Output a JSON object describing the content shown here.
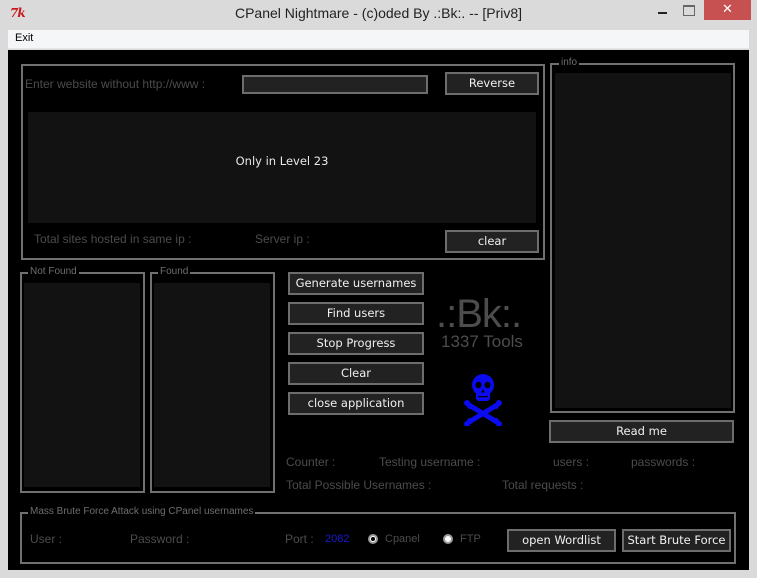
{
  "window": {
    "title": "CPanel Nightmare - (c)oded By .:Bk:. -- [Priv8]",
    "icon_text": "7k",
    "controls": {
      "minimize": "minimize-icon",
      "maximize": "maximize-icon",
      "close": "✕"
    }
  },
  "menubar": {
    "items": [
      {
        "label": "Exit"
      }
    ]
  },
  "reverse_ip": {
    "prompt_label": "Enter website without http://www :",
    "website_input": {
      "value": "",
      "placeholder": ""
    },
    "reverse_button": "Reverse",
    "output_text": "Only in Level 23",
    "total_sites_label": "Total sites hosted in same ip :",
    "server_ip_label": "Server ip :",
    "clear_button": "clear"
  },
  "info": {
    "frame_label": "info",
    "read_me_button": "Read me"
  },
  "lists": {
    "not_found_label": "Not Found",
    "found_label": "Found"
  },
  "actions": {
    "generate_usernames": "Generate usernames",
    "find_users": "Find users",
    "stop_progress": "Stop Progress",
    "clear": "Clear",
    "close_application": "close application"
  },
  "branding": {
    "logo_text": ".:Bk:.",
    "subtitle": "1337 Tools",
    "skull_icon": "skull-crossbones-icon",
    "skull_color": "#0b0bf0"
  },
  "stats": {
    "counter_label": "Counter :",
    "testing_username_label": "Testing username :",
    "users_label": "users :",
    "passwords_label": "passwords :",
    "total_possible_usernames_label": "Total Possible Usernames :",
    "total_requests_label": "Total requests :"
  },
  "brute_force": {
    "frame_label": "Mass Brute Force Attack using CPanel usernames",
    "user_label": "User :",
    "password_label": "Password :",
    "port_label": "Port :",
    "port_value": "2082",
    "port_color": "#1a1ad0",
    "protocol_options": [
      {
        "label": "Cpanel",
        "selected": true
      },
      {
        "label": "FTP",
        "selected": false
      }
    ],
    "open_wordlist_button": "open Wordlist",
    "start_button": "Start Brute Force"
  }
}
